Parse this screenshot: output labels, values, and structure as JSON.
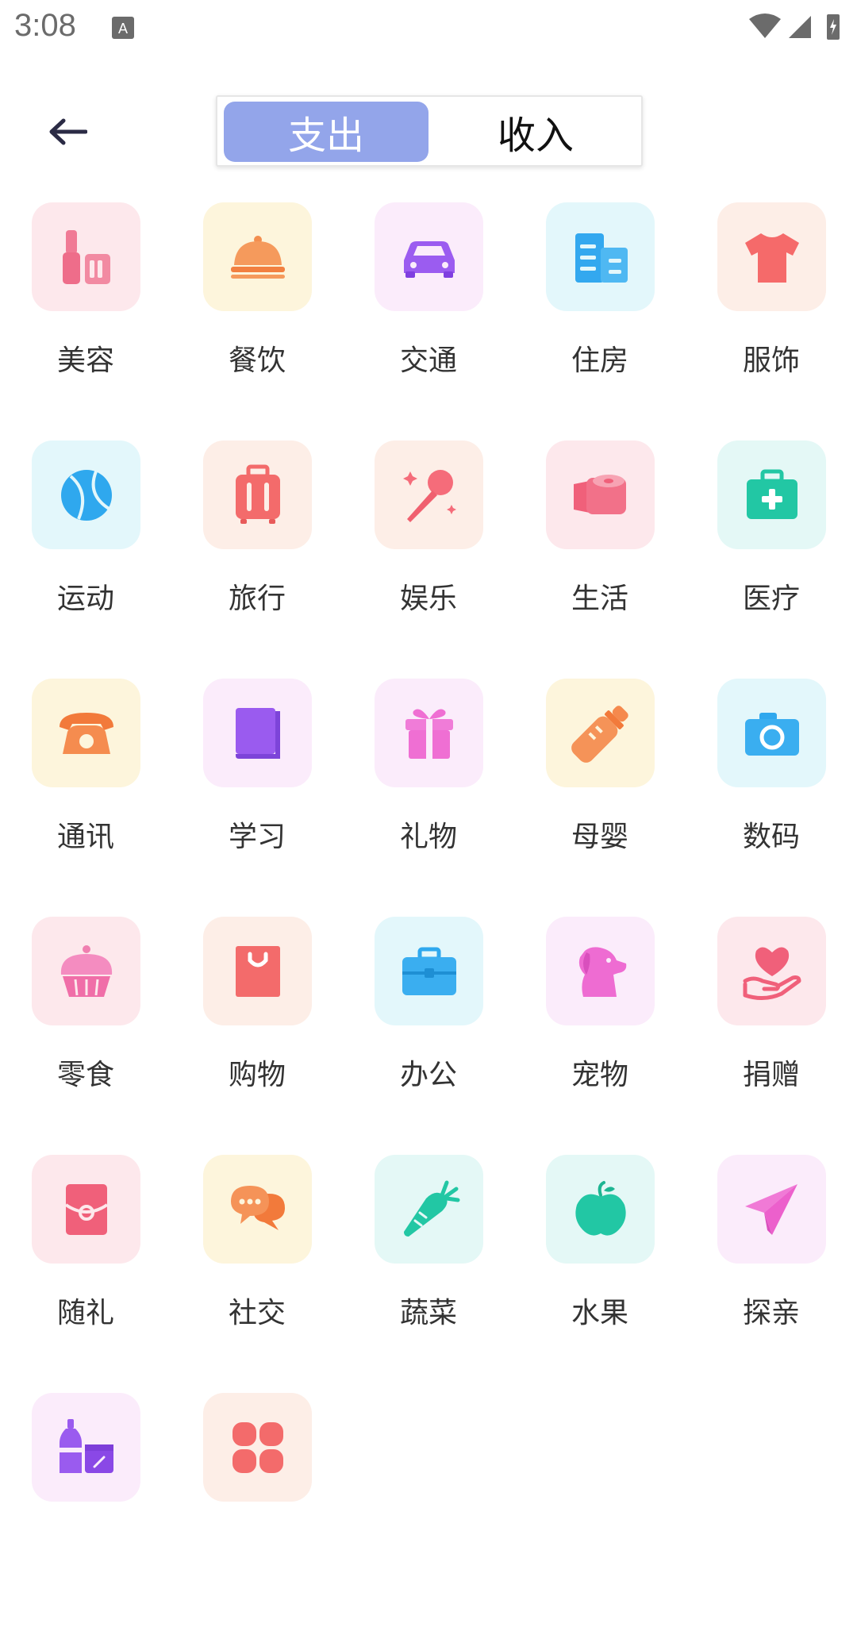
{
  "status": {
    "time": "3:08"
  },
  "header": {
    "tabs": [
      {
        "label": "支出",
        "active": true
      },
      {
        "label": "收入",
        "active": false
      }
    ]
  },
  "colors": {
    "accent": "#93a5ea"
  },
  "categories": [
    {
      "label": "美容",
      "icon": "lipstick-icon",
      "bg": "#fde8ec"
    },
    {
      "label": "餐饮",
      "icon": "dish-cloche-icon",
      "bg": "#fdf5dc"
    },
    {
      "label": "交通",
      "icon": "car-icon",
      "bg": "#fbecfb"
    },
    {
      "label": "住房",
      "icon": "building-icon",
      "bg": "#e3f7fb"
    },
    {
      "label": "服饰",
      "icon": "tshirt-icon",
      "bg": "#fdeee7"
    },
    {
      "label": "运动",
      "icon": "tennis-ball-icon",
      "bg": "#e3f7fb"
    },
    {
      "label": "旅行",
      "icon": "suitcase-icon",
      "bg": "#fdeee7"
    },
    {
      "label": "娱乐",
      "icon": "microphone-icon",
      "bg": "#fdeee7"
    },
    {
      "label": "生活",
      "icon": "toilet-paper-icon",
      "bg": "#fde8ec"
    },
    {
      "label": "医疗",
      "icon": "medical-kit-icon",
      "bg": "#e4f8f6"
    },
    {
      "label": "通讯",
      "icon": "telephone-icon",
      "bg": "#fdf5dc"
    },
    {
      "label": "学习",
      "icon": "book-icon",
      "bg": "#fbecfb"
    },
    {
      "label": "礼物",
      "icon": "gift-icon",
      "bg": "#fbecfb"
    },
    {
      "label": "母婴",
      "icon": "baby-bottle-icon",
      "bg": "#fdf5dc"
    },
    {
      "label": "数码",
      "icon": "camera-icon",
      "bg": "#e3f7fb"
    },
    {
      "label": "零食",
      "icon": "cupcake-icon",
      "bg": "#fde8ec"
    },
    {
      "label": "购物",
      "icon": "shopping-bag-icon",
      "bg": "#fdeee7"
    },
    {
      "label": "办公",
      "icon": "briefcase-icon",
      "bg": "#e3f7fb"
    },
    {
      "label": "宠物",
      "icon": "dog-icon",
      "bg": "#fbecfb"
    },
    {
      "label": "捐赠",
      "icon": "heart-hand-icon",
      "bg": "#fde8ec"
    },
    {
      "label": "随礼",
      "icon": "red-envelope-icon",
      "bg": "#fde8ec"
    },
    {
      "label": "社交",
      "icon": "chat-bubbles-icon",
      "bg": "#fdf5dc"
    },
    {
      "label": "蔬菜",
      "icon": "carrot-icon",
      "bg": "#e4f8f6"
    },
    {
      "label": "水果",
      "icon": "apple-icon",
      "bg": "#e4f8f6"
    },
    {
      "label": "探亲",
      "icon": "paper-plane-icon",
      "bg": "#fbecfb"
    },
    {
      "label": "",
      "icon": "bottles-icon",
      "bg": "#fbecfb"
    },
    {
      "label": "",
      "icon": "more-grid-icon",
      "bg": "#fdeee7"
    }
  ]
}
